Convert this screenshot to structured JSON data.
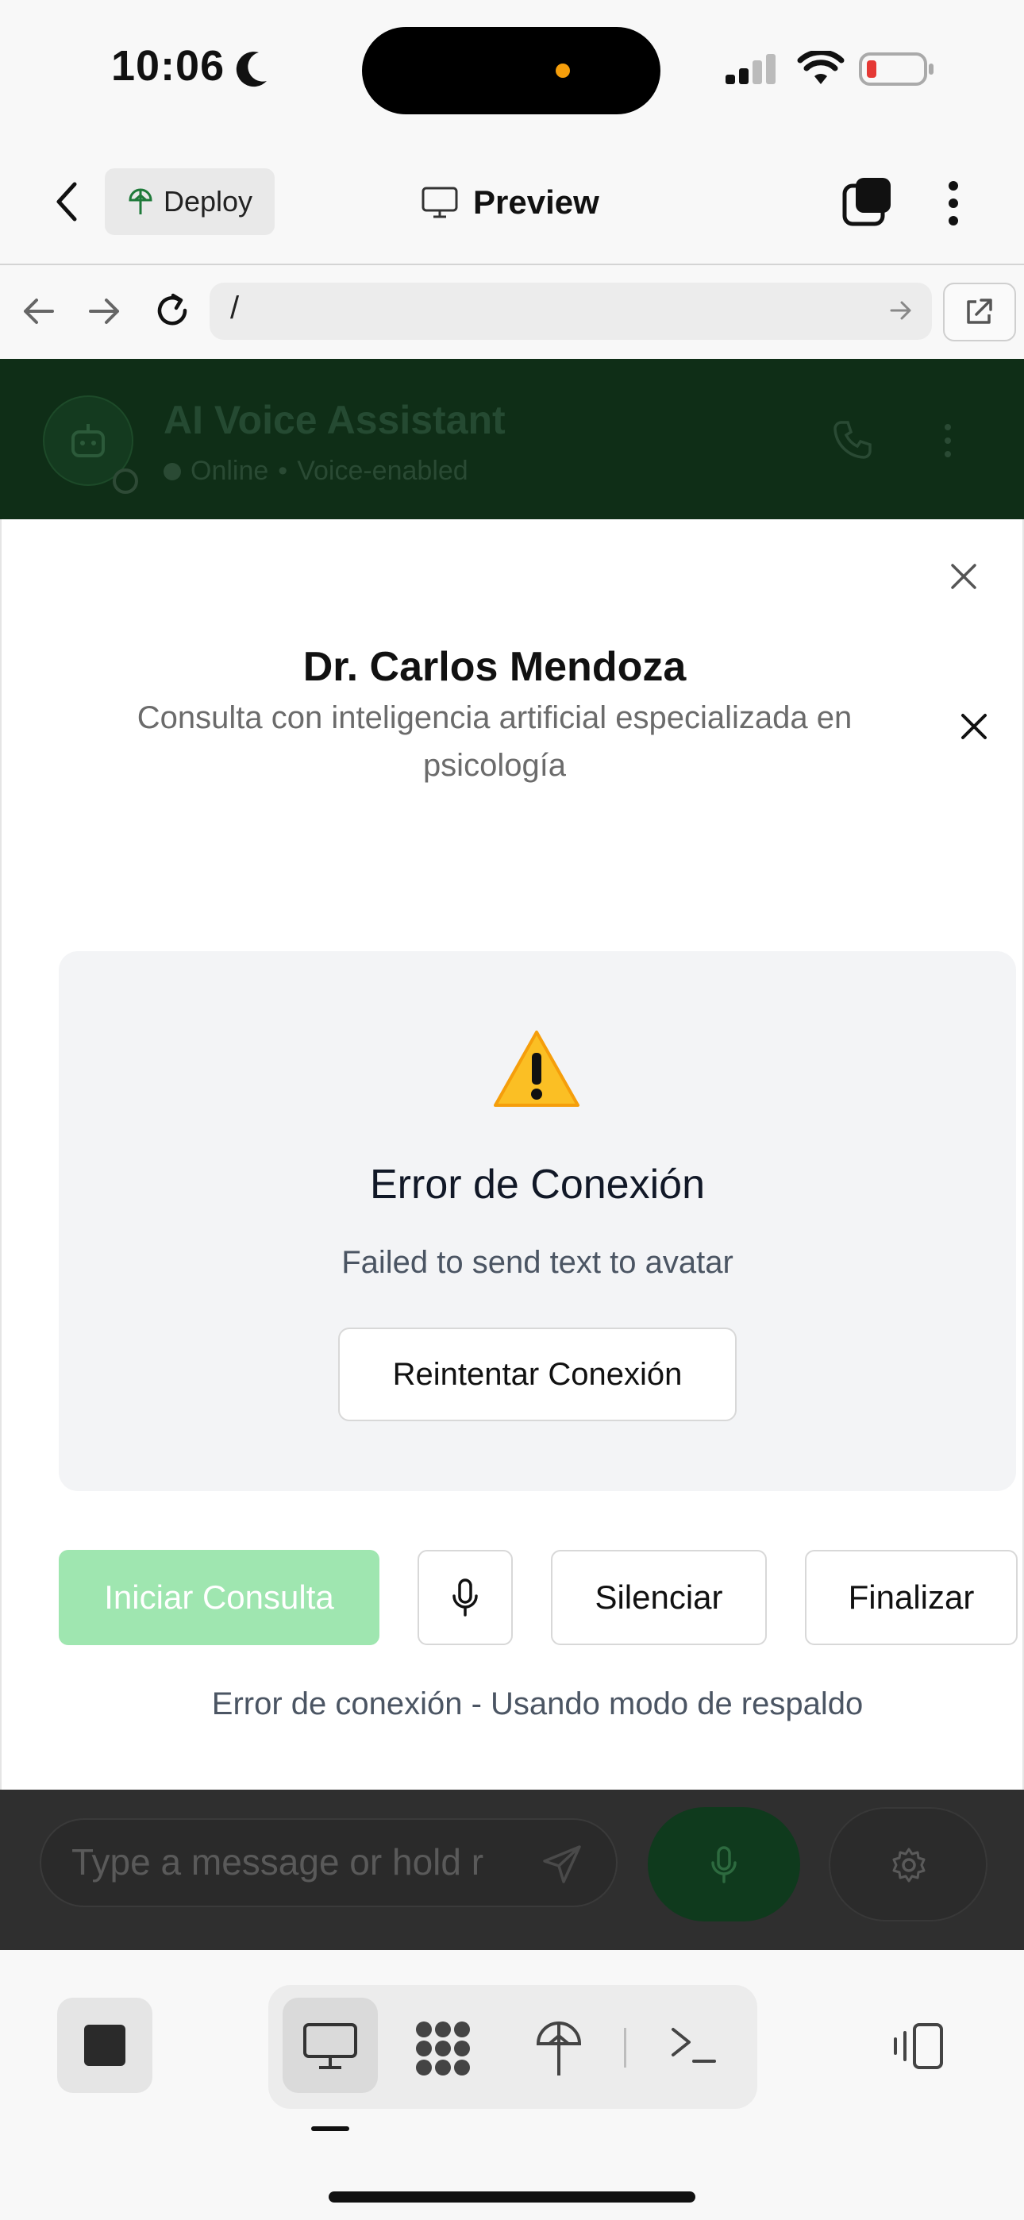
{
  "status_bar": {
    "time": "10:06"
  },
  "app_bar": {
    "deploy_label": "Deploy",
    "title": "Preview"
  },
  "url_bar": {
    "url": "/"
  },
  "chat_header": {
    "title": "AI Voice Assistant",
    "status": "Online",
    "separator": "•",
    "mode": "Voice-enabled"
  },
  "modal": {
    "doctor_name": "Dr. Carlos Mendoza",
    "description": "Consulta con inteligencia artificial especializada en psicología",
    "error": {
      "icon": "warning-icon",
      "title": "Error de Conexión",
      "message": "Failed to send text to avatar",
      "retry_label": "Reintentar Conexión"
    },
    "controls": {
      "start_label": "Iniciar Consulta",
      "mute_label": "Silenciar",
      "end_label": "Finalizar"
    },
    "status_text": "Error de conexión - Usando modo de respaldo"
  },
  "chat_input": {
    "placeholder": "Type a message or hold r"
  },
  "colors": {
    "brand_green": "#0f3a1d",
    "start_button_disabled": "#9fe6b0",
    "warning_yellow": "#fbbf24"
  }
}
